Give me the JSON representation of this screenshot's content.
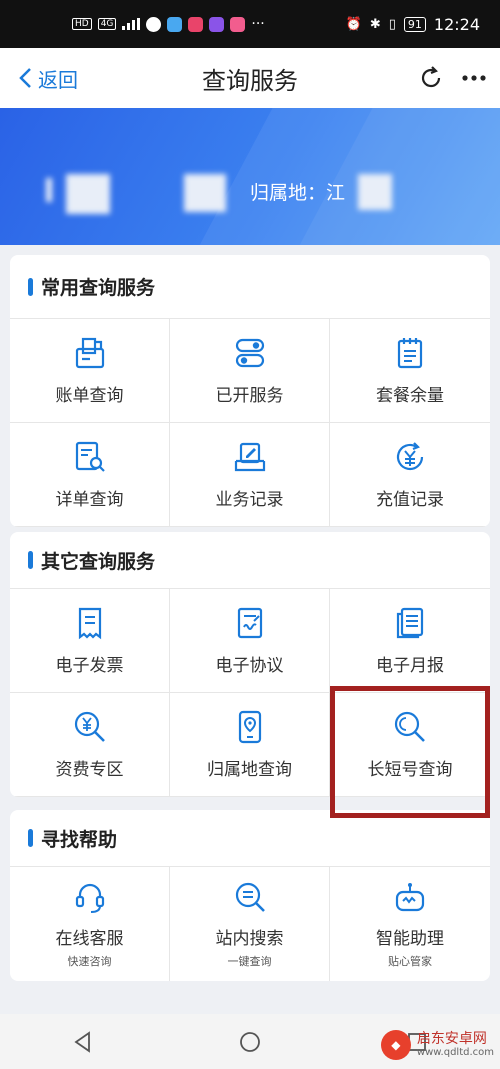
{
  "status_bar": {
    "left_badges": [
      "HD",
      "4G"
    ],
    "battery": "91",
    "time": "12:24"
  },
  "nav": {
    "back_label": "返回",
    "title": "查询服务"
  },
  "banner": {
    "attribution_label": "归属地：江"
  },
  "sections": [
    {
      "title": "常用查询服务",
      "items": [
        {
          "label": "账单查询",
          "icon": "bill-icon"
        },
        {
          "label": "已开服务",
          "icon": "toggle-icon"
        },
        {
          "label": "套餐余量",
          "icon": "notepad-icon"
        },
        {
          "label": "详单查询",
          "icon": "detail-search-icon"
        },
        {
          "label": "业务记录",
          "icon": "record-icon"
        },
        {
          "label": "充值记录",
          "icon": "yuan-refresh-icon"
        }
      ]
    },
    {
      "title": "其它查询服务",
      "items": [
        {
          "label": "电子发票",
          "icon": "invoice-icon"
        },
        {
          "label": "电子协议",
          "icon": "agreement-icon"
        },
        {
          "label": "电子月报",
          "icon": "report-icon"
        },
        {
          "label": "资费专区",
          "icon": "yuan-search-icon"
        },
        {
          "label": "归属地查询",
          "icon": "location-phone-icon"
        },
        {
          "label": "长短号查询",
          "icon": "search-icon"
        }
      ]
    },
    {
      "title": "寻找帮助",
      "items": [
        {
          "label": "在线客服",
          "sub": "快速咨询",
          "icon": "headset-icon"
        },
        {
          "label": "站内搜索",
          "sub": "一键查询",
          "icon": "list-search-icon"
        },
        {
          "label": "智能助理",
          "sub": "贴心管家",
          "icon": "robot-icon"
        }
      ]
    }
  ],
  "watermark": {
    "title": "启东安卓网",
    "url": "www.qdltd.com"
  },
  "colors": {
    "accent": "#1a7ad9",
    "banner": "#3c82f0",
    "highlight": "#a3211f"
  }
}
